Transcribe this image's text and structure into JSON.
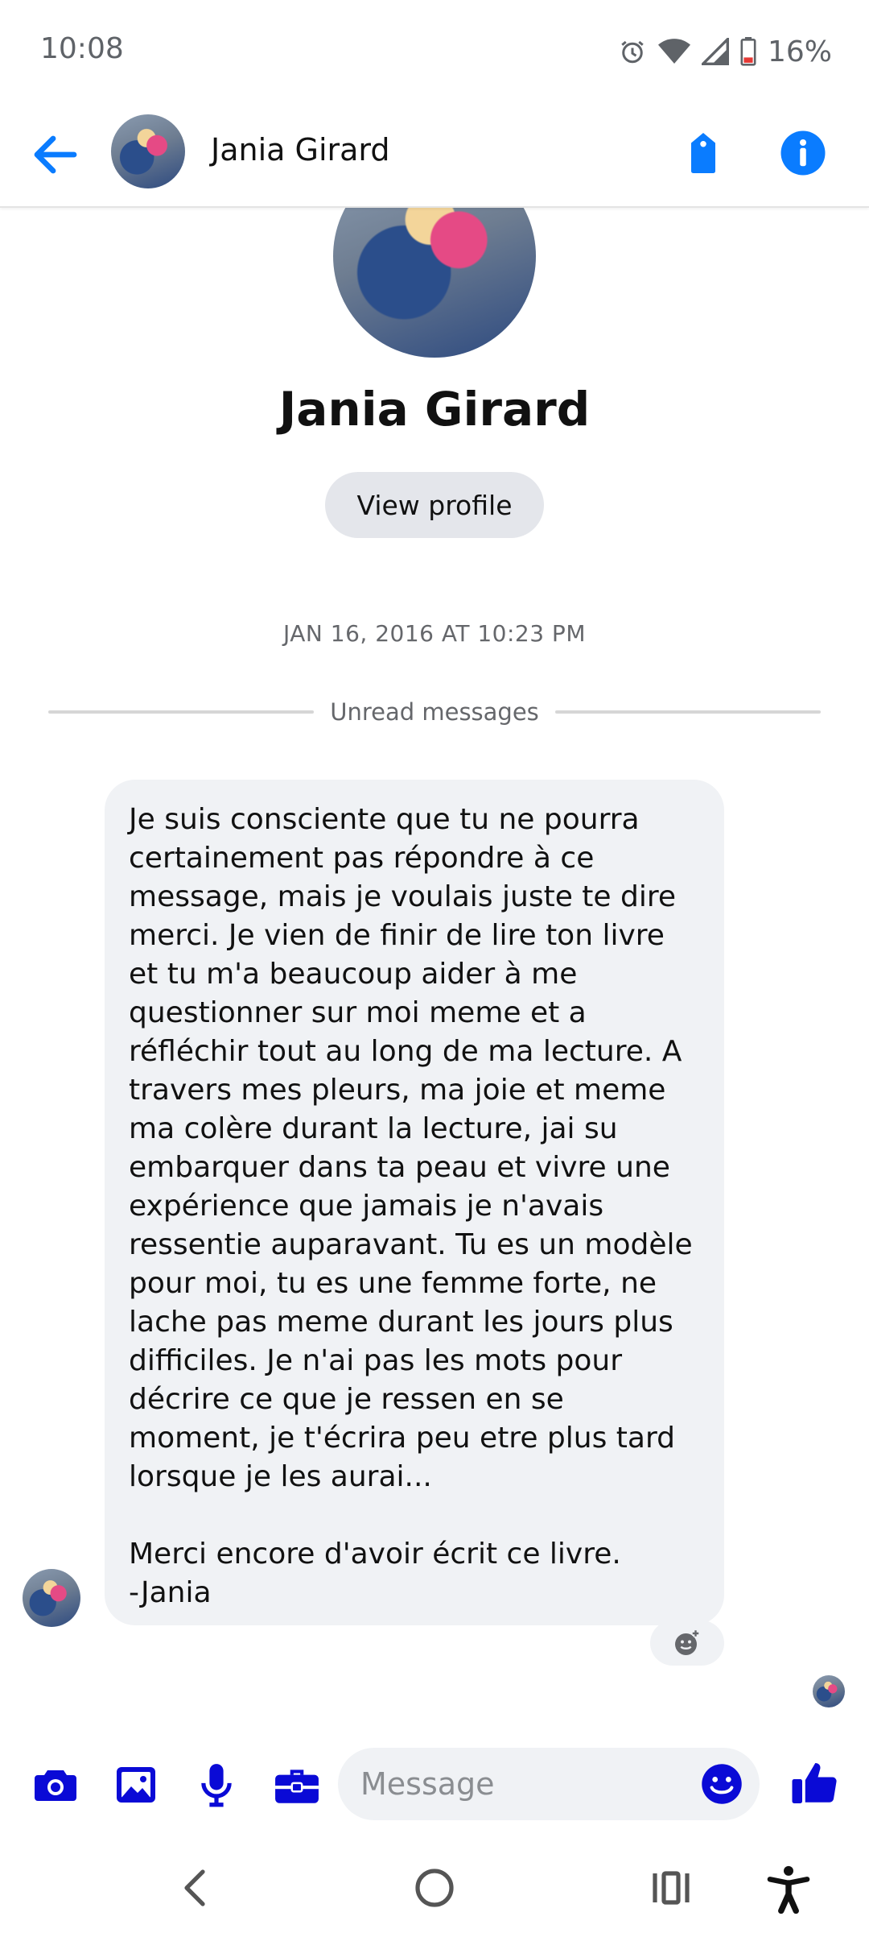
{
  "status_bar": {
    "time": "10:08",
    "battery": "16%",
    "icons": [
      "alarm-icon",
      "wifi-icon",
      "signal-icon",
      "battery-low-icon"
    ]
  },
  "header": {
    "contact_name": "Jania Girard",
    "icons": [
      "back-arrow-icon",
      "tag-icon",
      "info-icon"
    ]
  },
  "profile": {
    "name": "Jania Girard",
    "view_profile_label": "View profile"
  },
  "conversation": {
    "timestamp": "JAN 16, 2016 AT 10:23 PM",
    "unread_label": "Unread messages",
    "message_text": "Je suis consciente que tu ne pourra certainement pas répondre à ce message, mais je voulais juste te dire merci. Je vien de finir de lire ton livre et tu m'a beaucoup aider à me questionner sur moi meme et a réfléchir tout au long de ma lecture. A travers mes pleurs, ma joie et meme ma colère durant la lecture, jai su embarquer dans ta peau et vivre une expérience que jamais je n'avais ressentie auparavant. Tu es un modèle pour moi, tu es une femme forte, ne lache pas meme durant les jours plus difficiles. Je n'ai pas les mots pour décrire ce que je ressen en se moment, je t'écrira peu etre plus tard lorsque je les aurai...\n\nMerci encore d'avoir écrit ce livre.\n-Jania"
  },
  "composer": {
    "placeholder": "Message",
    "icons": [
      "camera-icon",
      "gallery-icon",
      "microphone-icon",
      "briefcase-icon",
      "emoji-icon",
      "thumbs-up-icon"
    ]
  },
  "colors": {
    "accent": "#0a7cff",
    "composer_icon": "#0a0ad6",
    "bubble": "#f0f2f5"
  }
}
